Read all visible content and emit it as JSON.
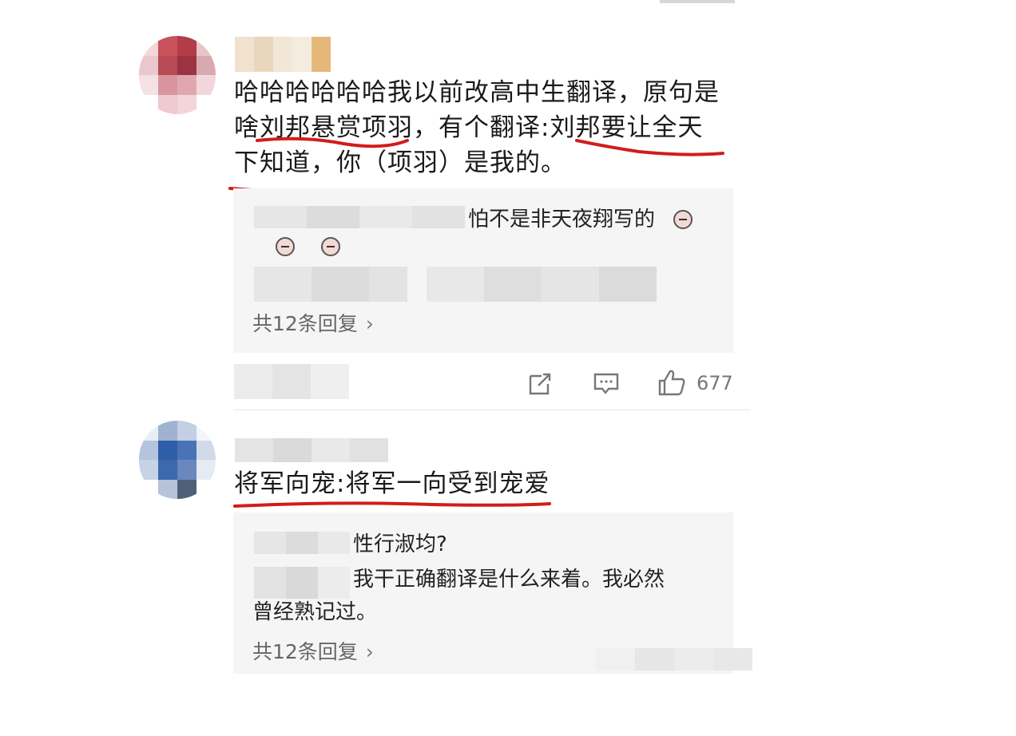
{
  "post1": {
    "content_line1": "哈哈哈哈哈哈我以前改高中生翻译，原句是",
    "content_line2": "啥刘邦悬赏项羽，有个翻译:刘邦要让全天",
    "content_line3": "下知道，你（项羽）是我的。",
    "reply1_text": "怕不是非天夜翔写的",
    "more_replies": "共12条回复",
    "like_count": "677",
    "icons": [
      "share-icon",
      "comment-icon",
      "like-icon"
    ]
  },
  "post2": {
    "content": "将军向宠:将军一向受到宠爱",
    "reply1_text": "性行淑均?",
    "reply2_line1": "我干正确翻译是什么来着。我必然",
    "reply2_line2": "曾经熟记过。",
    "more_replies": "共12条回复"
  },
  "colors": {
    "underline": "#d21c1c",
    "reply_bg": "#f5f5f5",
    "secondary_text": "#666666"
  }
}
